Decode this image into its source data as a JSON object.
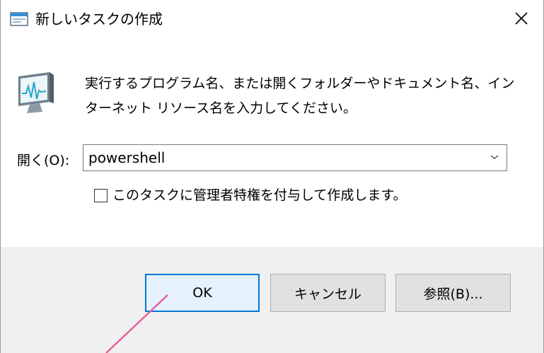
{
  "window": {
    "title": "新しいタスクの作成",
    "close_icon": "close-icon"
  },
  "description": {
    "line1": "実行するプログラム名、または開くフォルダーやドキュメント名、イン",
    "line2": "ターネット リソース名を入力してください。"
  },
  "open_field": {
    "label": "開く(O):",
    "value": "powershell"
  },
  "admin_checkbox": {
    "label": "このタスクに管理者特権を付与して作成します。",
    "checked": false
  },
  "buttons": {
    "ok": "OK",
    "cancel": "キャンセル",
    "browse": "参照(B)..."
  },
  "colors": {
    "focus_border": "#0078d7",
    "footer_bg": "#f0f0f0",
    "annotation_arrow": "#e6619e"
  }
}
